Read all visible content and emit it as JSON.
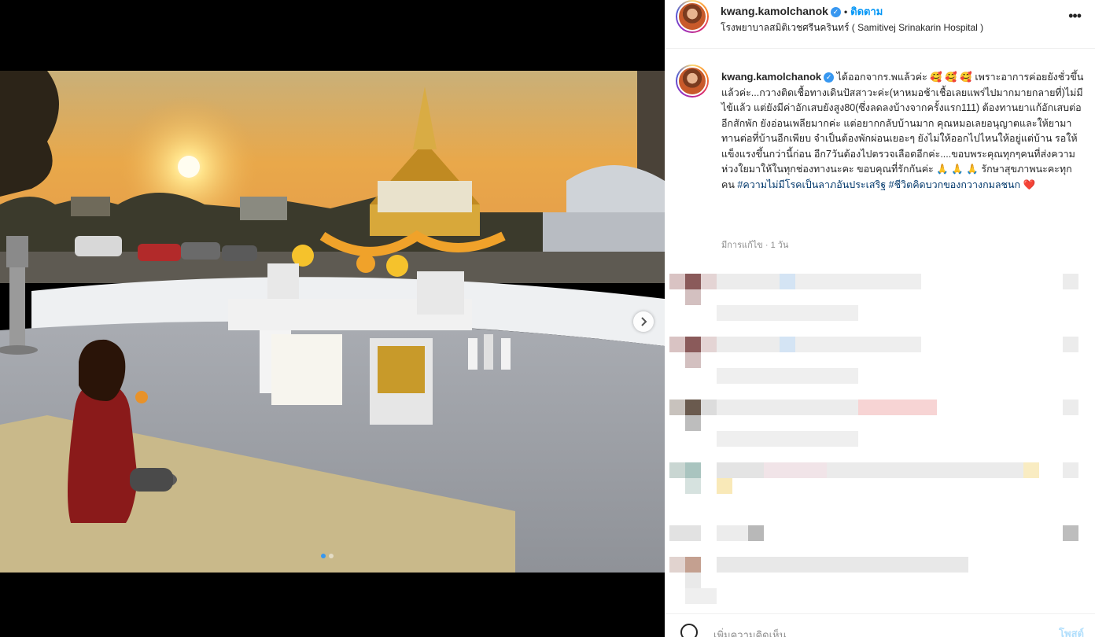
{
  "post": {
    "username": "kwang.kamolchanok",
    "follow_label": "ติดตาม",
    "bullet": "•",
    "location": "โรงพยาบาลสมิติเวชศรีนครินทร์ ( Samitivej Srinakarin Hospital )",
    "more_icon": "•••",
    "verified_icon": "✓"
  },
  "caption": {
    "username": "kwang.kamolchanok",
    "text_main": "ได้ออกจากร.พแล้วค่ะ 🥰 🥰 🥰 เพราะอาการค่อยยังชั่วขึ้นแล้วค่ะ...กวางติดเชื้อทางเดินปัสสาวะค่ะ(หาหมอช้าเชื้อเลยแพร่ไปมากมายกลายที่)ไม่มีไข้แล้ว แต่ยังมีค่าอักเสบยังสูง80(ซึ่งลดลงบ้างจากครั้งแรก111) ต้องทานยาแก้อักเสบต่ออีกสักพัก ยังอ่อนเพลียมากค่ะ แต่อยากกลับบ้านมาก คุณหมอเลยอนุญาตและให้ยามาทานต่อที่บ้านอีกเพียบ จำเป็นต้องพักผ่อนเยอะๆ ยังไม่ให้ออกไปไหนให้อยู่แต่บ้าน รอให้แข็งแรงขึ้นกว่านี้ก่อน อีก7วันต้องไปตรวจเลือดอีกค่ะ....ขอบพระคุณทุกๆคนที่ส่งความห่วงใยมาให้ในทุกช่องทางนะคะ ขอบคุณที่รักกันค่ะ 🙏 🙏 🙏 รักษาสุขภาพนะคะทุกคน ",
    "hashtag1": "#ความไม่มีโรคเป็นลาภอันประเสริฐ",
    "hashtag2": "#ชีวิตคิดบวกของกวางกมลชนก",
    "heart": "❤️",
    "meta": "มีการแก้ไข · 1 วัน"
  },
  "footer": {
    "add_comment_placeholder": "เพิ่มความคิดเห็น...",
    "post_label": "โพสต์"
  },
  "colors": {
    "accent": "#0095f6",
    "hashtag": "#00376b",
    "muted": "#8e8e8e"
  }
}
